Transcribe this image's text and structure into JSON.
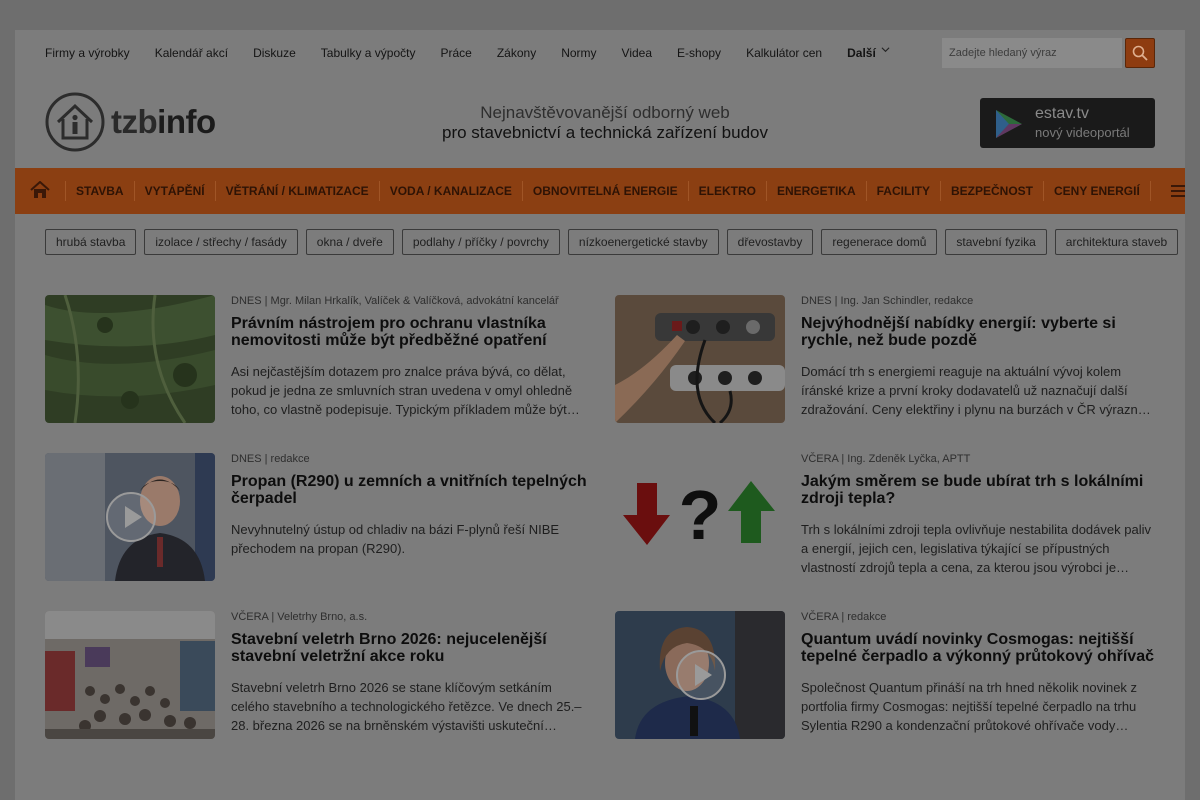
{
  "topnav": {
    "items": [
      "Firmy a výrobky",
      "Kalendář akcí",
      "Diskuze",
      "Tabulky a výpočty",
      "Práce",
      "Zákony",
      "Normy",
      "Videa",
      "E-shopy",
      "Kalkulátor cen"
    ],
    "more": "Další",
    "search_placeholder": "Zadejte hledaný výraz"
  },
  "header": {
    "logo_prefix": "tzb",
    "logo_suffix": "info",
    "tagline_1": "Nejnavštěvovanější odborný web",
    "tagline_2": "pro stavebnictví a technická zařízení budov",
    "estav_title": "estav.tv",
    "estav_sub": "nový videoportál"
  },
  "mainnav": {
    "items": [
      "STAVBA",
      "VYTÁPĚNÍ",
      "VĚTRÁNÍ / KLIMATIZACE",
      "VODA / KANALIZACE",
      "OBNOVITELNÁ ENERGIE",
      "ELEKTRO",
      "ENERGETIKA",
      "FACILITY",
      "BEZPEČNOST",
      "CENY ENERGIÍ"
    ]
  },
  "tags": [
    "hrubá stavba",
    "izolace / střechy / fasády",
    "okna / dveře",
    "podlahy / příčky / povrchy",
    "nízkoenergetické stavby",
    "dřevostavby",
    "regenerace domů",
    "stavební fyzika",
    "architektura staveb"
  ],
  "articles": [
    {
      "meta": "DNES | Mgr. Milan Hrkalík, Valíček & Valíčková, advokátní kancelář",
      "title": "Právním nástrojem pro ochranu vlastníka nemovitosti může být předběžné opatření",
      "excerpt": "Asi nejčastějším dotazem pro znalce práva bývá, co dělat, pokud je jedna ze smluvních stran uvedena v omyl ohledně toho, co vlastně podepisuje. Typickým příkladem může být…"
    },
    {
      "meta": "DNES | Ing. Jan Schindler, redakce",
      "title": "Nejvýhodnější nabídky energií: vyberte si rychle, než bude pozdě",
      "excerpt": "Domácí trh s energiemi reaguje na aktuální vývoj kolem íránské krize a první kroky dodavatelů už naznačují další zdražování. Ceny elektřiny i plynu na burzách v ČR výrazn…"
    },
    {
      "meta": "DNES | redakce",
      "title": "Propan (R290) u zemních a vnitřních tepelných čerpadel",
      "excerpt": "Nevyhnutelný ústup od chladiv na bázi F-plynů řeší NIBE přechodem na propan (R290)."
    },
    {
      "meta": "VČERA | Ing. Zdeněk Lyčka, APTT",
      "title": "Jakým směrem se bude ubírat trh s lokálními zdroji tepla?",
      "excerpt": "Trh s lokálními zdroji tepla ovlivňuje nestabilita dodávek paliv a energií, jejich cen, legislativa týkající se přípustných vlastností zdrojů tepla a cena, za kterou jsou výrobci je…"
    },
    {
      "meta": "VČERA | Veletrhy Brno, a.s.",
      "title": "Stavební veletrh Brno 2026: nejucelenější stavební veletržní akce roku",
      "excerpt": "Stavební veletrh Brno 2026 se stane klíčovým setkáním celého stavebního a technologického řetězce. Ve dnech 25.–28. března 2026 se na brněnském výstavišti uskuteční…"
    },
    {
      "meta": "VČERA | redakce",
      "title": "Quantum uvádí novinky Cosmogas: nejtišší tepelné čerpadlo a výkonný průtokový ohřívač",
      "excerpt": "Společnost Quantum přináší na trh hned několik novinek z portfolia firmy Cosmogas: nejtišší tepelné čerpadlo na trhu Sylentia R290 a kondenzační průtokové ohřívače vody…"
    }
  ],
  "colors": {
    "accent": "#8b3f12",
    "overlay": "#7c7c7c"
  }
}
